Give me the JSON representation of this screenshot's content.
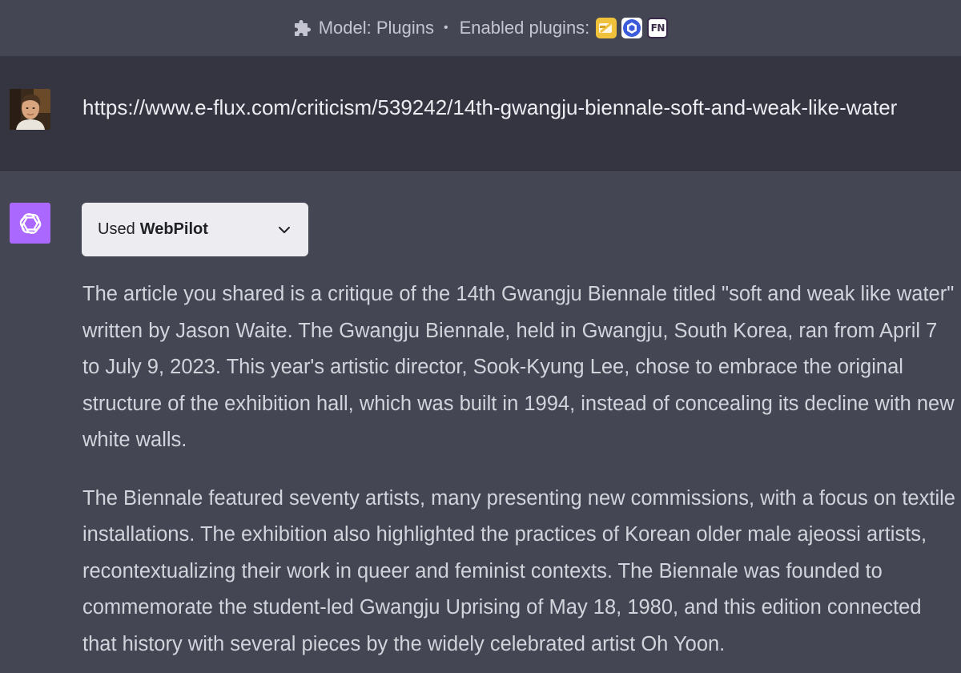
{
  "header": {
    "model_label": "Model: Plugins",
    "separator": "•",
    "enabled_label": "Enabled plugins:",
    "plugins": [
      {
        "icon": "plugin-yellow-icon"
      },
      {
        "icon": "plugin-blue-ring-icon"
      },
      {
        "icon": "plugin-fn-icon",
        "text": "FN"
      }
    ]
  },
  "user_message": {
    "avatar": "user-avatar",
    "text": "https://www.e-flux.com/criticism/539242/14th-gwangju-biennale-soft-and-weak-like-water"
  },
  "assistant_message": {
    "logo": "chatgpt-logo-icon",
    "plugin_used": {
      "prefix": "Used",
      "name": "WebPilot",
      "icon": "chevron-down-icon"
    },
    "paragraphs": [
      "The article you shared is a critique of the 14th Gwangju Biennale titled \"soft and weak like water\" written by Jason Waite. The Gwangju Biennale, held in Gwangju, South Korea, ran from April 7 to July 9, 2023. This year's artistic director, Sook-Kyung Lee, chose to embrace the original structure of the exhibition hall, which was built in 1994, instead of concealing its decline with new white walls.",
      "The Biennale featured seventy artists, many presenting new commissions, with a focus on textile installations. The exhibition also highlighted the practices of Korean older male ajeossi artists, recontextualizing their work in queer and feminist contexts. The Biennale was founded to commemorate the student-led Gwangju Uprising of May 18, 1980, and this edition connected that history with several pieces by the widely celebrated artist Oh Yoon."
    ]
  },
  "colors": {
    "assistant_bg": "#444654",
    "user_bg": "#343541",
    "gpt_logo_bg": "#ab68ff",
    "pill_bg": "#ececf1"
  }
}
